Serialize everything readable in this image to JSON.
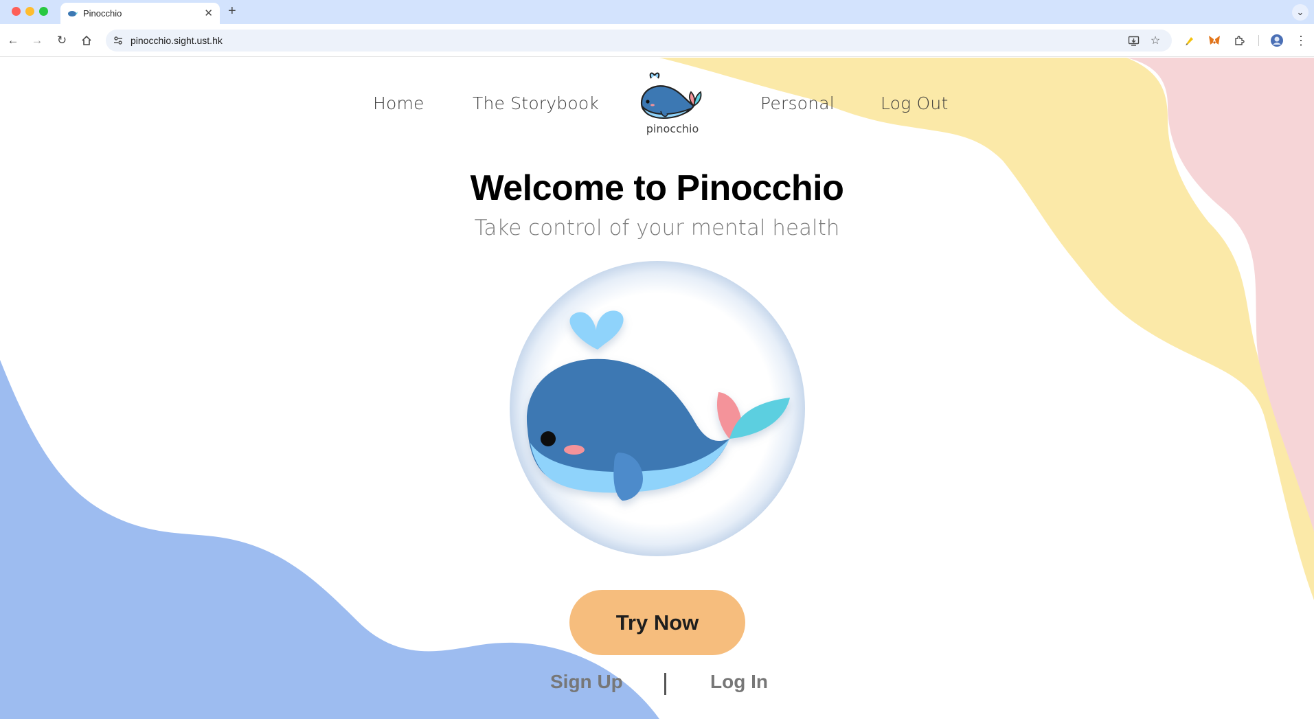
{
  "browser": {
    "tab_title": "Pinocchio",
    "tab_close": "✕",
    "new_tab": "+",
    "url": "pinocchio.sight.ust.hk",
    "icons": [
      "back-arrow-icon",
      "forward-arrow-icon",
      "reload-icon",
      "home-icon",
      "site-info-icon",
      "install-app-icon",
      "bookmark-star-icon",
      "extension-highlighter-icon",
      "extension-metamask-icon",
      "extensions-puzzle-icon",
      "profile-avatar-icon",
      "menu-dots-icon"
    ]
  },
  "nav": {
    "home": "Home",
    "storybook": "The Storybook",
    "logo_text": "pinocchio",
    "personal": "Personal",
    "logout": "Log Out"
  },
  "hero": {
    "title_prefix": "Welcome to",
    "title_brand": "Pinocchio",
    "subtitle": "Take control of your mental health",
    "cta": "Try Now",
    "signup": "Sign Up",
    "login": "Log In"
  },
  "colors": {
    "blob_blue": "#9dbcf0",
    "blob_yellow": "#fbe9a8",
    "blob_pink": "#f6d5d7",
    "cta": "#f6bd7d",
    "brand_underline": "#f6bd85",
    "whale_body": "#3c78b3",
    "whale_belly": "#8fd3fb"
  }
}
